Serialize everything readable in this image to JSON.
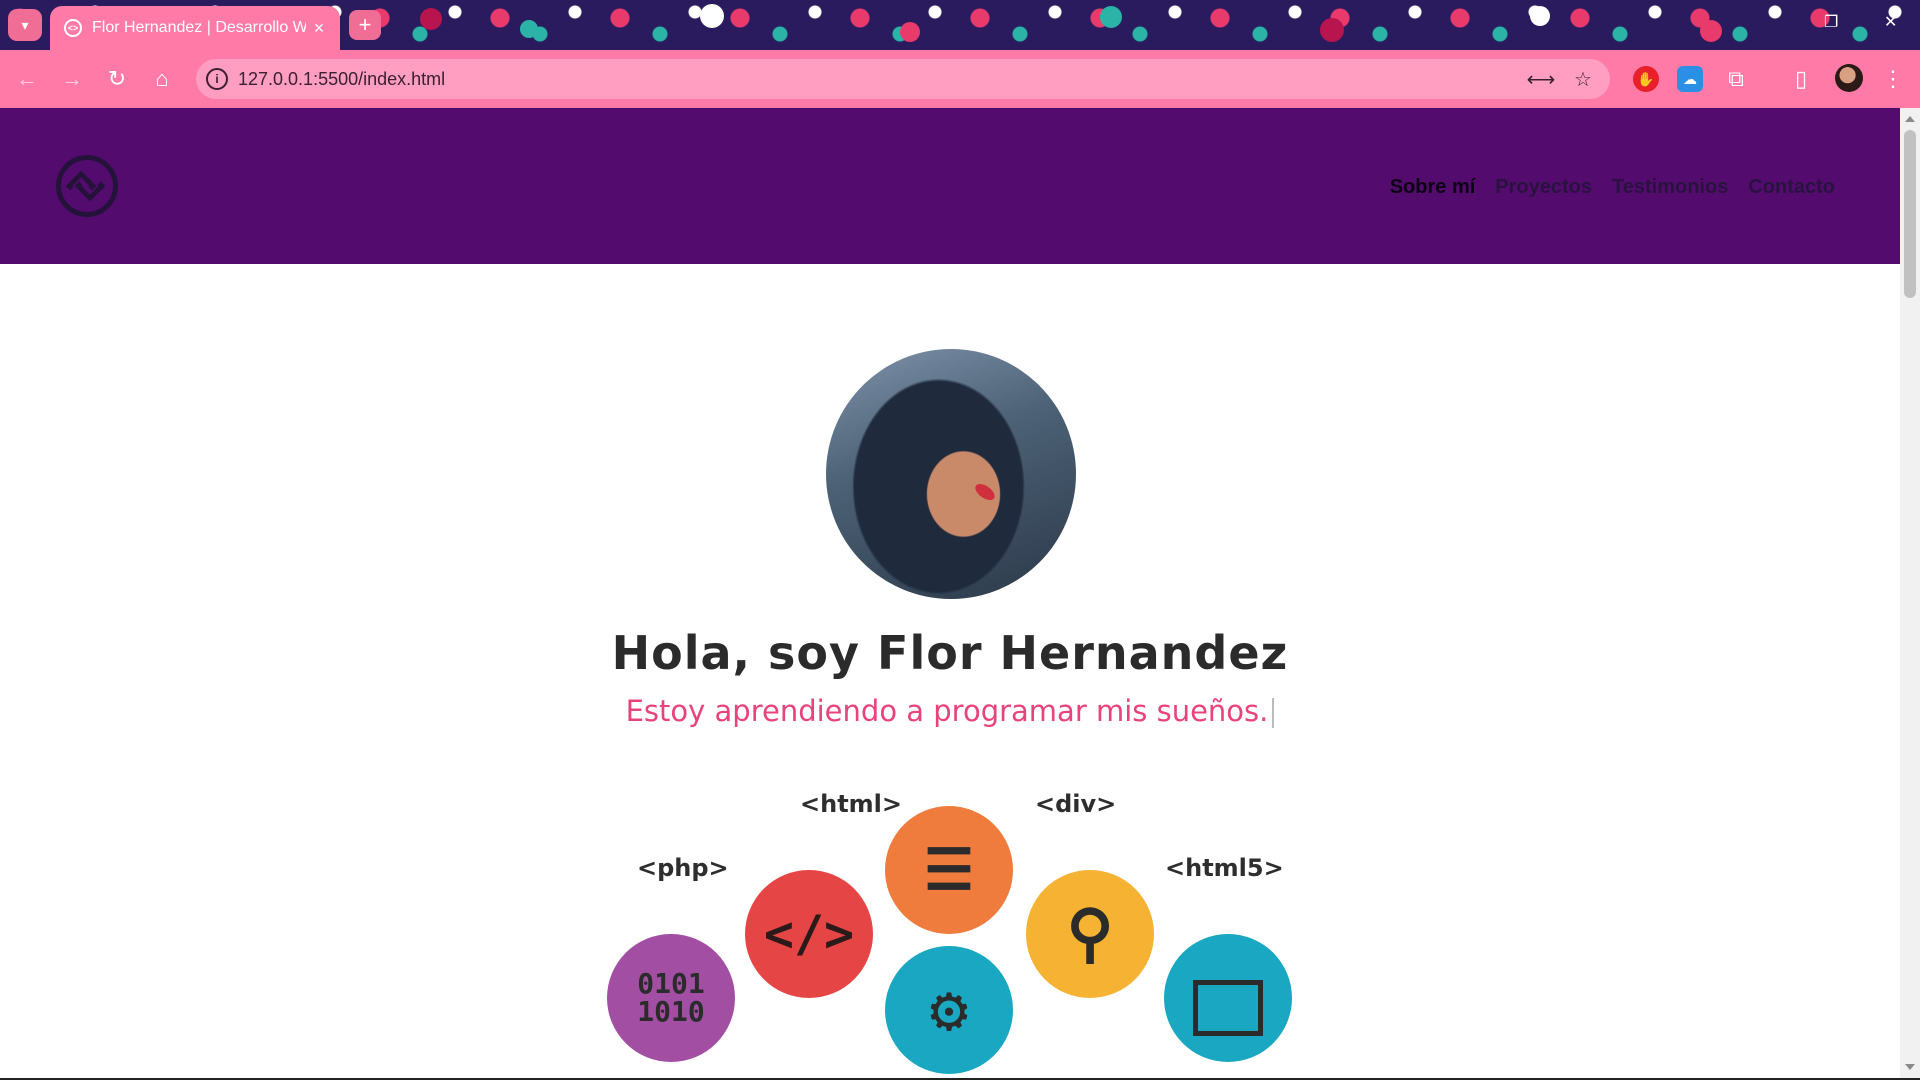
{
  "browser": {
    "tab_title": "Flor Hernandez | Desarrollo Web",
    "tab_close": "×",
    "new_tab": "+",
    "url": "127.0.0.1:5500/index.html",
    "back": "←",
    "forward": "→",
    "reload": "↻",
    "home": "⌂",
    "menu": "⋮",
    "accent_color": "#ff7aa6"
  },
  "site": {
    "header_color": "#530b6e",
    "nav": [
      {
        "label": "Sobre mí",
        "active": true
      },
      {
        "label": "Proyectos"
      },
      {
        "label": "Testimonios"
      },
      {
        "label": "Contacto"
      }
    ],
    "hero": {
      "title": "Hola, soy Flor Hernandez",
      "subtitle": "Estoy aprendiendo a programar mis sueños."
    },
    "tech_tags": [
      "<html>",
      "<div>",
      "<php>",
      "<html5>"
    ],
    "binary_text": "0101\n1010",
    "code_glyph": "</>",
    "chat_glyph": "☰",
    "search_glyph": "⚲",
    "gear_glyph": "⚙"
  }
}
